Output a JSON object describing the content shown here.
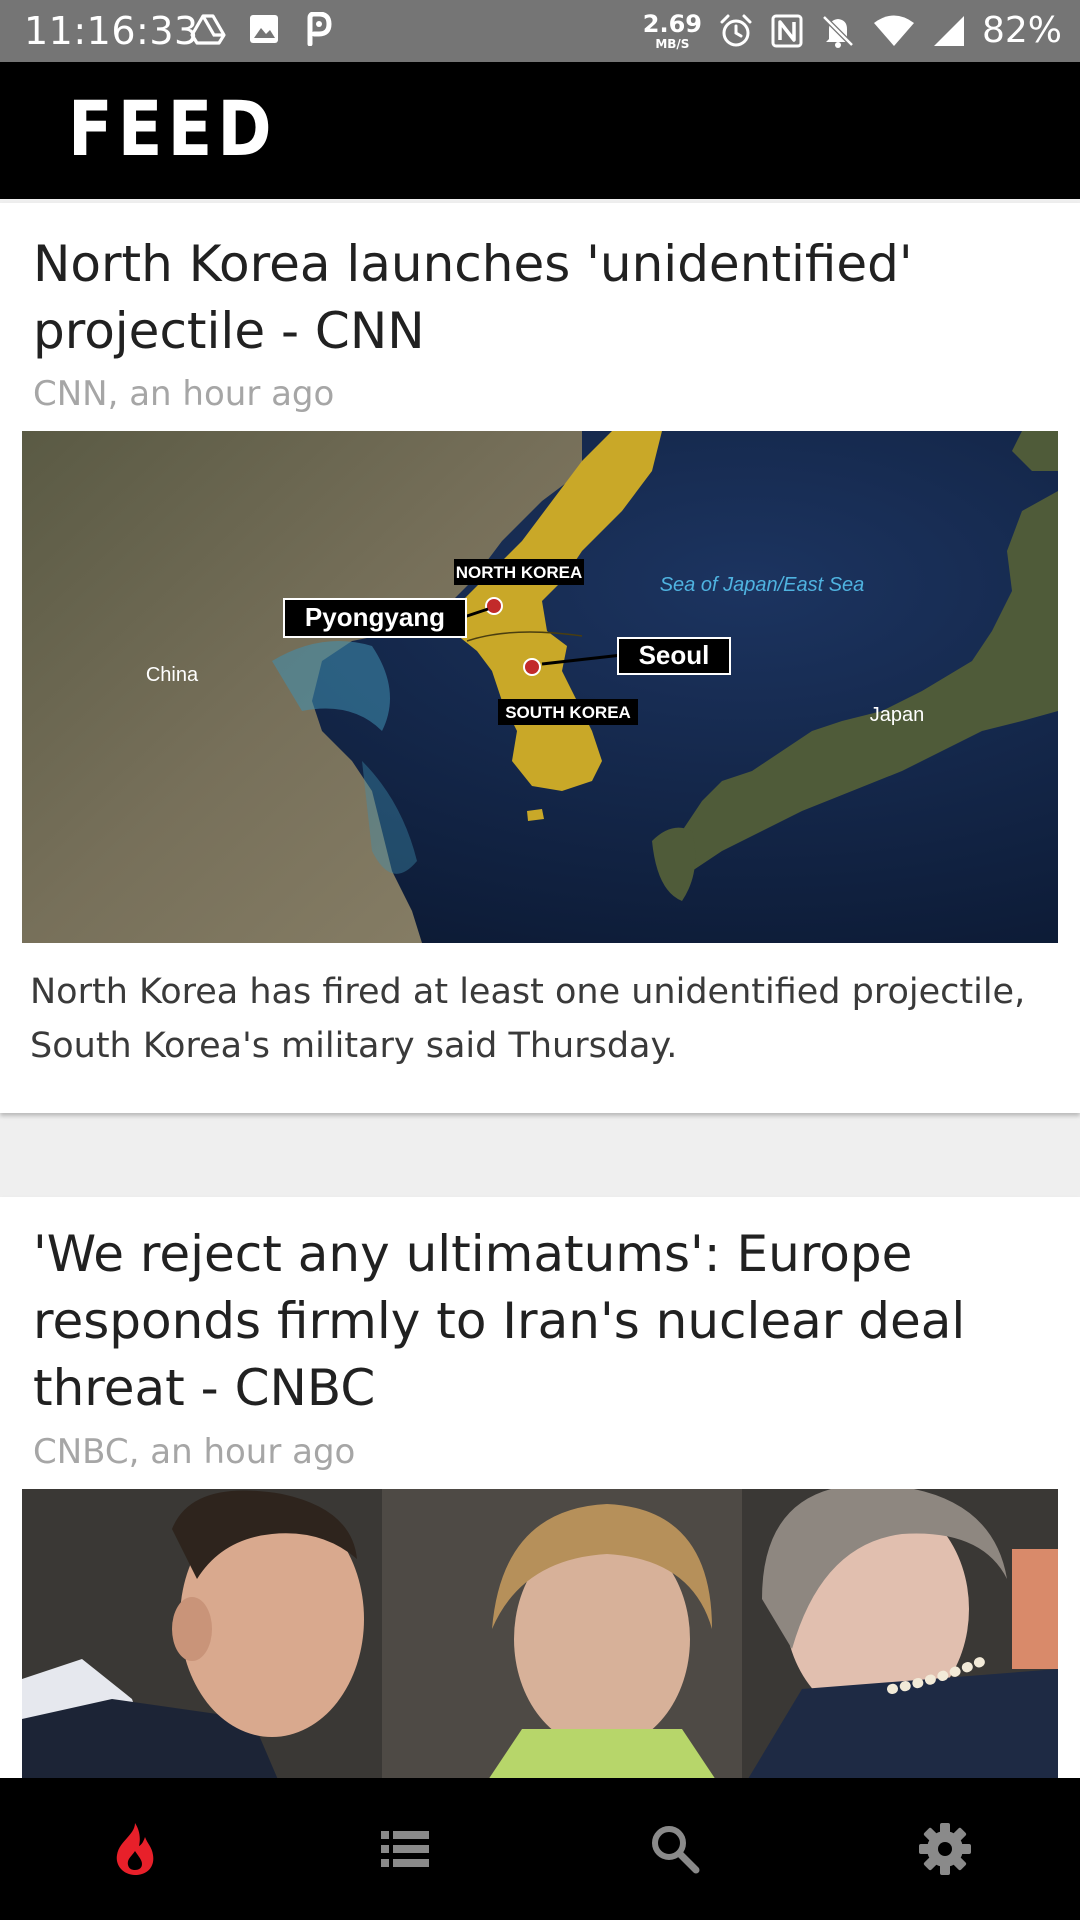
{
  "status_bar": {
    "time": "11:16:33",
    "net_speed_value": "2.69",
    "net_speed_unit": "MB/S",
    "battery": "82%",
    "left_icons": [
      "drive-icon",
      "image-icon",
      "parking-icon"
    ],
    "right_icons": [
      "alarm-icon",
      "nfc-icon",
      "bell-off-icon",
      "wifi-icon",
      "signal-icon"
    ]
  },
  "app_bar": {
    "title": "FEED"
  },
  "feed": {
    "items": [
      {
        "title": "North Korea launches 'unidentified' projectile - CNN",
        "meta": "CNN, an hour ago",
        "summary": "North Korea has fired at least one unidentified projectile, South Korea's military said Thursday.",
        "image_labels": {
          "north_korea": "NORTH KOREA",
          "pyongyang": "Pyongyang",
          "seoul": "Seoul",
          "south_korea": "SOUTH KOREA",
          "sea": "Sea of Japan/East Sea",
          "china": "China",
          "japan": "Japan"
        }
      },
      {
        "title": "'We reject any ultimatums': Europe responds firmly to Iran's nuclear deal threat - CNBC",
        "meta": "CNBC, an hour ago"
      }
    ]
  },
  "bottom_nav": {
    "items": [
      {
        "icon": "flame-icon",
        "active": true
      },
      {
        "icon": "list-icon",
        "active": false
      },
      {
        "icon": "search-icon",
        "active": false
      },
      {
        "icon": "gear-icon",
        "active": false
      }
    ],
    "active_color": "#e8202a",
    "inactive_color": "#8a8a8a"
  },
  "colors": {
    "status_bar_bg": "#757575",
    "app_bar_bg": "#000000",
    "feed_bg": "#efefef",
    "card_bg": "#ffffff",
    "meta_text": "#a6a6a6"
  }
}
